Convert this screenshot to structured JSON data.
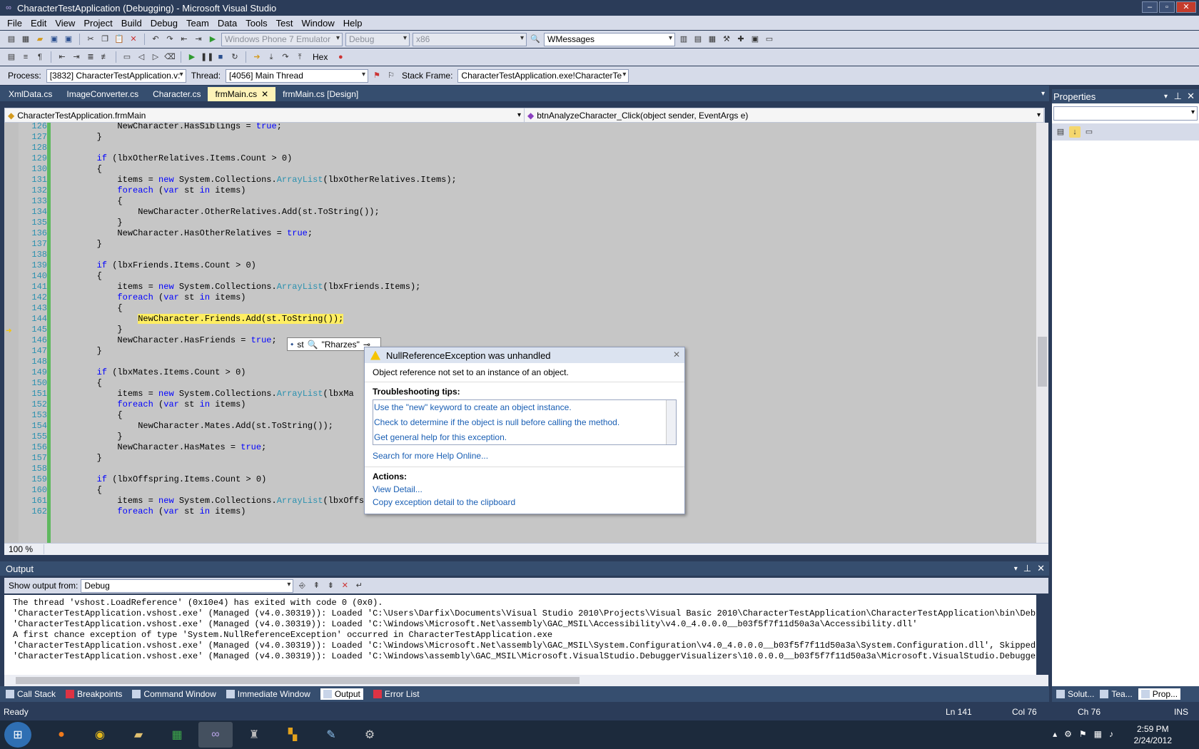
{
  "window": {
    "title": "CharacterTestApplication (Debugging) - Microsoft Visual Studio"
  },
  "menu": [
    "File",
    "Edit",
    "View",
    "Project",
    "Build",
    "Debug",
    "Team",
    "Data",
    "Tools",
    "Test",
    "Window",
    "Help"
  ],
  "toolbar": {
    "emulator": "Windows Phone 7 Emulator",
    "config": "Debug",
    "platform": "x86",
    "find": "WMessages",
    "hex": "Hex"
  },
  "debugbar": {
    "process_label": "Process:",
    "process": "[3832] CharacterTestApplication.v:",
    "thread_label": "Thread:",
    "thread": "[4056] Main Thread",
    "frame_label": "Stack Frame:",
    "frame": "CharacterTestApplication.exe!CharacterTe"
  },
  "tabs": [
    "XmlData.cs",
    "ImageConverter.cs",
    "Character.cs",
    "frmMain.cs",
    "frmMain.cs [Design]"
  ],
  "nav": {
    "left": "CharacterTestApplication.frmMain",
    "right": "btnAnalyzeCharacter_Click(object sender, EventArgs e)"
  },
  "editor": {
    "zoom": "100 %"
  },
  "code": [
    {
      "n": "126",
      "t": "            NewCharacter.HasSiblings = true;"
    },
    {
      "n": "127",
      "t": "        }"
    },
    {
      "n": "128",
      "t": ""
    },
    {
      "n": "129",
      "t": "        if (lbxOtherRelatives.Items.Count > 0)"
    },
    {
      "n": "130",
      "t": "        {"
    },
    {
      "n": "131",
      "t": "            items = new System.Collections.ArrayList(lbxOtherRelatives.Items);"
    },
    {
      "n": "132",
      "t": "            foreach (var st in items)"
    },
    {
      "n": "133",
      "t": "            {"
    },
    {
      "n": "134",
      "t": "                NewCharacter.OtherRelatives.Add(st.ToString());"
    },
    {
      "n": "135",
      "t": "            }"
    },
    {
      "n": "136",
      "t": "            NewCharacter.HasOtherRelatives = true;"
    },
    {
      "n": "137",
      "t": "        }"
    },
    {
      "n": "138",
      "t": ""
    },
    {
      "n": "139",
      "t": "        if (lbxFriends.Items.Count > 0)"
    },
    {
      "n": "140",
      "t": "        {"
    },
    {
      "n": "141",
      "t": "            items = new System.Collections.ArrayList(lbxFriends.Items);"
    },
    {
      "n": "142",
      "t": "            foreach (var st in items)"
    },
    {
      "n": "143",
      "t": "            {"
    },
    {
      "n": "144",
      "t": "                NewCharacter.Friends.Add(st.ToString());"
    },
    {
      "n": "145",
      "t": "            }"
    },
    {
      "n": "146",
      "t": "            NewCharacter.HasFriends = true;"
    },
    {
      "n": "147",
      "t": "        }"
    },
    {
      "n": "148",
      "t": ""
    },
    {
      "n": "149",
      "t": "        if (lbxMates.Items.Count > 0)"
    },
    {
      "n": "150",
      "t": "        {"
    },
    {
      "n": "151",
      "t": "            items = new System.Collections.ArrayList(lbxMa"
    },
    {
      "n": "152",
      "t": "            foreach (var st in items)"
    },
    {
      "n": "153",
      "t": "            {"
    },
    {
      "n": "154",
      "t": "                NewCharacter.Mates.Add(st.ToString());"
    },
    {
      "n": "155",
      "t": "            }"
    },
    {
      "n": "156",
      "t": "            NewCharacter.HasMates = true;"
    },
    {
      "n": "157",
      "t": "        }"
    },
    {
      "n": "158",
      "t": ""
    },
    {
      "n": "159",
      "t": "        if (lbxOffspring.Items.Count > 0)"
    },
    {
      "n": "160",
      "t": "        {"
    },
    {
      "n": "161",
      "t": "            items = new System.Collections.ArrayList(lbxOffspring.Items);"
    },
    {
      "n": "162",
      "t": "            foreach (var st in items)"
    }
  ],
  "datatip": {
    "var": "st",
    "value": "\"Rharzes\""
  },
  "exception": {
    "title": "NullReferenceException was unhandled",
    "message": "Object reference not set to an instance of an object.",
    "tips_heading": "Troubleshooting tips:",
    "tips": [
      "Use the \"new\" keyword to create an object instance.",
      "Check to determine if the object is null before calling the method.",
      "Get general help for this exception."
    ],
    "help_link": "Search for more Help Online...",
    "actions_heading": "Actions:",
    "actions": [
      "View Detail...",
      "Copy exception detail to the clipboard"
    ]
  },
  "output": {
    "title": "Output",
    "show_label": "Show output from:",
    "source": "Debug",
    "lines": [
      "The thread 'vshost.LoadReference' (0x10e4) has exited with code 0 (0x0).",
      "'CharacterTestApplication.vshost.exe' (Managed (v4.0.30319)): Loaded 'C:\\Users\\Darfix\\Documents\\Visual Studio 2010\\Projects\\Visual Basic 2010\\CharacterTestApplication\\CharacterTestApplication\\bin\\Debug\\Cha",
      "'CharacterTestApplication.vshost.exe' (Managed (v4.0.30319)): Loaded 'C:\\Windows\\Microsoft.Net\\assembly\\GAC_MSIL\\Accessibility\\v4.0_4.0.0.0__b03f5f7f11d50a3a\\Accessibility.dll'",
      "A first chance exception of type 'System.NullReferenceException' occurred in CharacterTestApplication.exe",
      "'CharacterTestApplication.vshost.exe' (Managed (v4.0.30319)): Loaded 'C:\\Windows\\Microsoft.Net\\assembly\\GAC_MSIL\\System.Configuration\\v4.0_4.0.0.0__b03f5f7f11d50a3a\\System.Configuration.dll', Skipped loadi",
      "'CharacterTestApplication.vshost.exe' (Managed (v4.0.30319)): Loaded 'C:\\Windows\\assembly\\GAC_MSIL\\Microsoft.VisualStudio.DebuggerVisualizers\\10.0.0.0__b03f5f7f11d50a3a\\Microsoft.VisualStudio.DebuggerVisua"
    ]
  },
  "bottom_tabs": [
    "Call Stack",
    "Breakpoints",
    "Command Window",
    "Immediate Window",
    "Output",
    "Error List"
  ],
  "properties": {
    "title": "Properties"
  },
  "right_tabs": [
    "Solut...",
    "Tea...",
    "Prop..."
  ],
  "status": {
    "ready": "Ready",
    "ln": "Ln 141",
    "col": "Col 76",
    "ch": "Ch 76",
    "mode": "INS"
  },
  "clock": {
    "time": "2:59 PM",
    "date": "2/24/2012"
  },
  "colors": {
    "chrome": "#2b3c59",
    "toolbar": "#d6dbe9",
    "highlight": "#ffee62",
    "link": "#1a5fb4"
  }
}
